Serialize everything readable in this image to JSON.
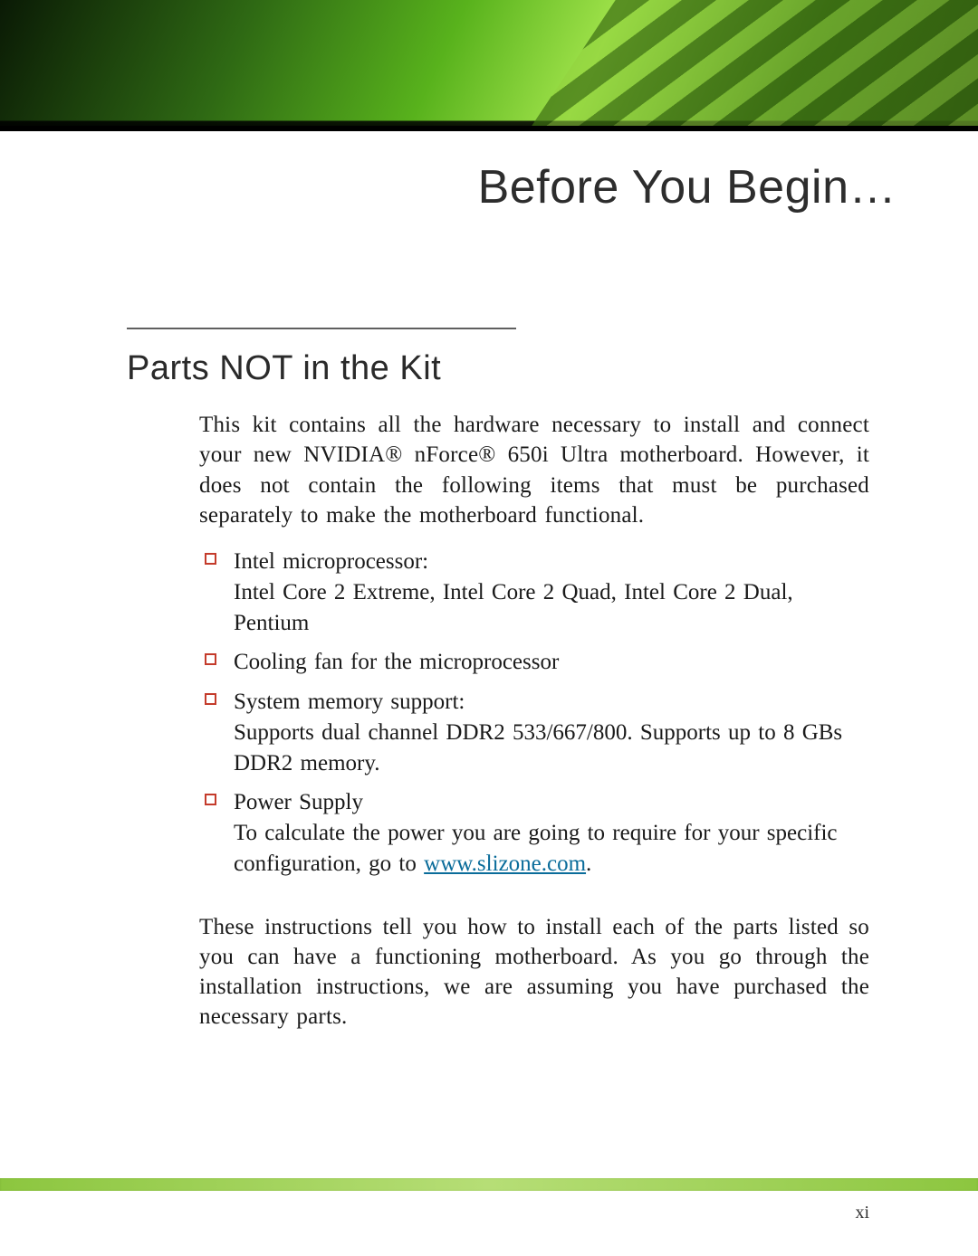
{
  "page": {
    "title": "Before You Begin…",
    "page_number": "xi"
  },
  "section": {
    "title": "Parts NOT in the Kit",
    "intro": "This kit contains all the hardware necessary to install and connect your new NVIDIA® nForce® 650i Ultra motherboard. However, it does not contain the following items that must be purchased separately to make the motherboard functional.",
    "items": [
      {
        "lead": "Intel microprocessor:",
        "detail": "Intel Core 2 Extreme, Intel Core 2 Quad, Intel Core 2 Dual, Pentium"
      },
      {
        "lead": "Cooling fan for the microprocessor",
        "detail": ""
      },
      {
        "lead": "System memory support:",
        "detail": "Supports dual channel DDR2 533/667/800. Supports up to 8 GBs DDR2 memory."
      },
      {
        "lead": "Power Supply",
        "detail_pre": "To calculate the power you are going to require for your specific configuration, go to ",
        "link_text": "www.slizone.com",
        "detail_post": "."
      }
    ],
    "outro": "These instructions tell you how to install each of the parts listed so you can have a functioning motherboard. As you go through the installation instructions, we are assuming you have purchased the necessary parts."
  }
}
